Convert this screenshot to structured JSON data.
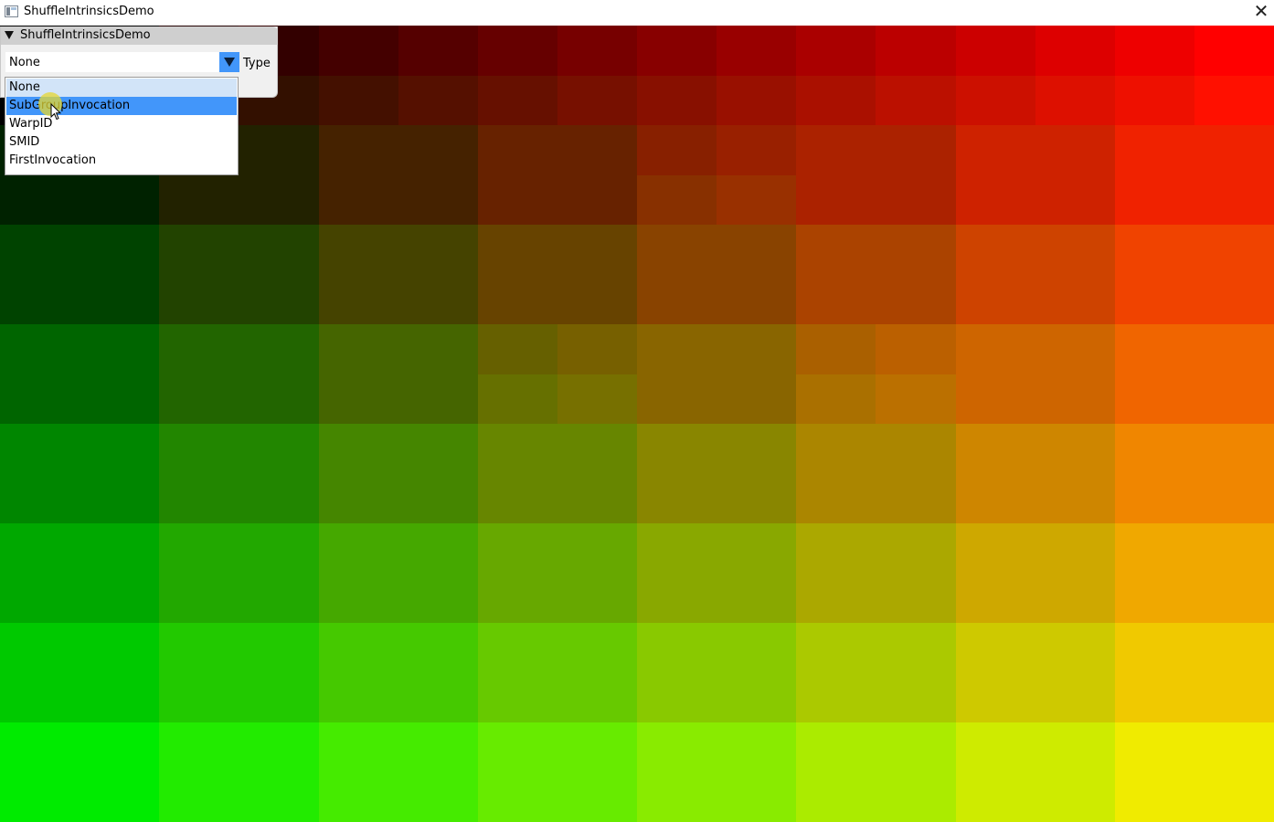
{
  "window": {
    "title": "ShuffleIntrinsicsDemo",
    "close_glyph": "✕",
    "icon": "app-window-icon"
  },
  "panel": {
    "title": "ShuffleIntrinsicsDemo",
    "collapse_icon": "triangle-down-icon",
    "combo": {
      "value": "None",
      "label": "Type",
      "arrow_icon": "triangle-down-icon",
      "accent_color": "#4296fa",
      "options": [
        "None",
        "SubGroupInvocation",
        "WarpID",
        "SMID",
        "FirstInvocation"
      ],
      "selected_option": "None",
      "hovered_option": "SubGroupInvocation"
    }
  },
  "render": {
    "grid_columns": 8,
    "grid_rows": 8,
    "description_colors": {
      "top_left": "#000000",
      "top_right": "#ff0000",
      "bottom_left": "#00ff00",
      "bottom_right": "#ffff00"
    }
  }
}
